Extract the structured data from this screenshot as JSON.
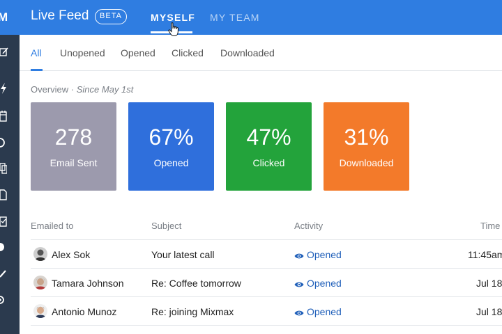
{
  "rail": {
    "logo": "M",
    "icons": [
      "compose-icon",
      "bolt-icon",
      "calendar-icon",
      "circle-icon",
      "copy-icon",
      "document-icon",
      "clipboard-icon",
      "pie-chart-icon",
      "pencil-icon",
      "settings-icon"
    ]
  },
  "header": {
    "title": "Live Feed",
    "badge": "BETA",
    "tabs": [
      {
        "label": "MYSELF",
        "active": true
      },
      {
        "label": "MY TEAM",
        "active": false
      }
    ]
  },
  "subtabs": [
    {
      "label": "All",
      "active": true
    },
    {
      "label": "Unopened",
      "active": false
    },
    {
      "label": "Opened",
      "active": false
    },
    {
      "label": "Clicked",
      "active": false
    },
    {
      "label": "Downloaded",
      "active": false
    }
  ],
  "overview": {
    "label": "Overview ·",
    "since": "Since May 1st"
  },
  "cards": [
    {
      "value": "278",
      "label": "Email Sent",
      "color": "#9c9aad"
    },
    {
      "value": "67%",
      "label": "Opened",
      "color": "#2f6fdc"
    },
    {
      "value": "47%",
      "label": "Clicked",
      "color": "#23a33b"
    },
    {
      "value": "31%",
      "label": "Downloaded",
      "color": "#f37a2a"
    }
  ],
  "table": {
    "headers": {
      "emailed_to": "Emailed to",
      "subject": "Subject",
      "activity": "Activity",
      "time": "Time"
    },
    "rows": [
      {
        "name": "Alex Sok",
        "subject": "Your latest call",
        "activity": "Opened",
        "time": "11:45am"
      },
      {
        "name": "Tamara Johnson",
        "subject": "Re: Coffee tomorrow",
        "activity": "Opened",
        "time": "Jul 18"
      },
      {
        "name": "Antonio Munoz",
        "subject": "Re: joining Mixmax",
        "activity": "Opened",
        "time": "Jul 18"
      }
    ]
  }
}
